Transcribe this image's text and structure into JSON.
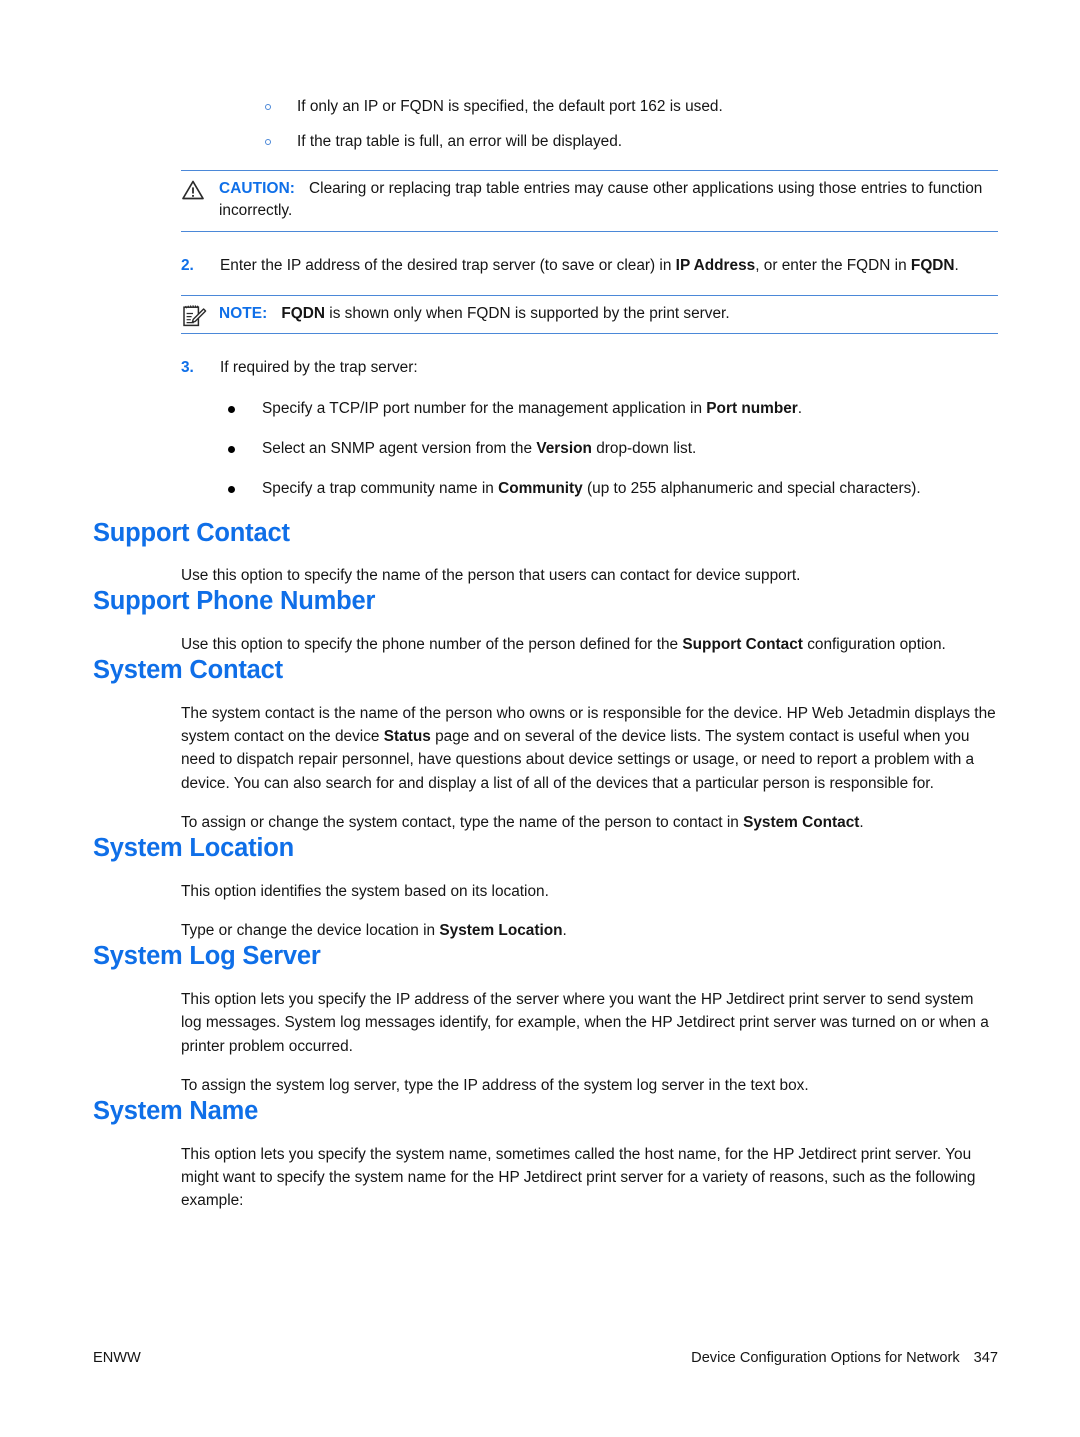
{
  "document": {
    "page_number": "347",
    "footer_left": "ENWW",
    "footer_right": "Device Configuration Options for Network",
    "accent_color": "#0f6fe8",
    "rule_color": "#4b88d8"
  },
  "sub_bullets": [
    {
      "text": "If only an IP or FQDN is specified, the default port 162 is used."
    },
    {
      "text": "If the trap table is full, an error will be displayed."
    }
  ],
  "caution": {
    "icon": "warning-triangle-icon",
    "label": "CAUTION:",
    "text": "Clearing or replacing trap table entries may cause other applications using those entries to function incorrectly."
  },
  "note": {
    "icon": "notepad-pencil-icon",
    "label": "NOTE:",
    "text_bold_lead": "FQDN",
    "text_rest": " is shown only when FQDN is supported by the print server."
  },
  "steps": [
    {
      "marker": "2.",
      "part1": "Enter the IP address of the desired trap server (to save or clear) in ",
      "bold1": "IP Address",
      "part2": ", or enter the FQDN in ",
      "bold2": "FQDN",
      "part3": "."
    },
    {
      "marker": "3.",
      "part1": "If required by the trap server:",
      "bold1": "",
      "part2": "",
      "bold2": "",
      "part3": ""
    }
  ],
  "bullets": [
    {
      "pre": "Specify a TCP/IP port number for the management application in ",
      "bold": "Port number",
      "post": "."
    },
    {
      "pre": "Select an SNMP agent version from the ",
      "bold": "Version",
      "post": " drop-down list."
    },
    {
      "pre": "Specify a trap community name in ",
      "bold": "Community",
      "post": " (up to 255 alphanumeric and special characters)."
    }
  ],
  "sections": [
    {
      "heading": "Support Contact",
      "paragraphs": [
        {
          "pre": "Use this option to specify the name of the person that users can contact for device support.",
          "bold": "",
          "post": ""
        }
      ]
    },
    {
      "heading": "Support Phone Number",
      "paragraphs": [
        {
          "pre": "Use this option to specify the phone number of the person defined for the ",
          "bold": "Support Contact",
          "post": " configuration option."
        }
      ]
    },
    {
      "heading": "System Contact",
      "paragraphs": [
        {
          "pre": "The system contact is the name of the person who owns or is responsible for the device. HP Web Jetadmin displays the system contact on the device ",
          "bold": "Status",
          "post": " page and on several of the device lists. The system contact is useful when you need to dispatch repair personnel, have questions about device settings or usage, or need to report a problem with a device. You can also search for and display a list of all of the devices that a particular person is responsible for."
        },
        {
          "pre": "To assign or change the system contact, type the name of the person to contact in ",
          "bold": "System Contact",
          "post": "."
        }
      ]
    },
    {
      "heading": "System Location",
      "paragraphs": [
        {
          "pre": "This option identifies the system based on its location.",
          "bold": "",
          "post": ""
        },
        {
          "pre": "Type or change the device location in ",
          "bold": "System Location",
          "post": "."
        }
      ]
    },
    {
      "heading": "System Log Server",
      "paragraphs": [
        {
          "pre": "This option lets you specify the IP address of the server where you want the HP Jetdirect print server to send system log messages. System log messages identify, for example, when the HP Jetdirect print server was turned on or when a printer problem occurred.",
          "bold": "",
          "post": ""
        },
        {
          "pre": "To assign the system log server, type the IP address of the system log server in the text box.",
          "bold": "",
          "post": ""
        }
      ]
    },
    {
      "heading": "System Name",
      "paragraphs": [
        {
          "pre": "This option lets you specify the system name, sometimes called the host name, for the HP Jetdirect print server. You might want to specify the system name for the HP Jetdirect print server for a variety of reasons, such as the following example:",
          "bold": "",
          "post": ""
        }
      ]
    }
  ]
}
